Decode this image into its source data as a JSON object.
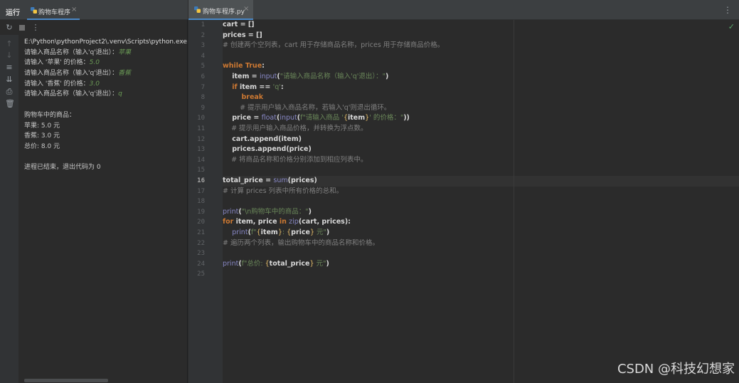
{
  "run_panel": {
    "title": "运行",
    "tab_label": "购物车程序",
    "tab_close": "×",
    "console_lines": [
      {
        "text": "E:\\Python\\pythonProject2\\.venv\\Scripts\\python.exe",
        "input": ""
      },
      {
        "text": "请输入商品名称（输入'q'退出）：",
        "input": "苹果"
      },
      {
        "text": "请输入 '苹果' 的价格：",
        "input": "5.0"
      },
      {
        "text": "请输入商品名称（输入'q'退出）：",
        "input": "香蕉"
      },
      {
        "text": "请输入 '香蕉' 的价格：",
        "input": "3.0"
      },
      {
        "text": "请输入商品名称（输入'q'退出）：",
        "input": "q"
      },
      {
        "text": "",
        "input": ""
      },
      {
        "text": "购物车中的商品：",
        "input": ""
      },
      {
        "text": "苹果: 5.0 元",
        "input": ""
      },
      {
        "text": "香蕉: 3.0 元",
        "input": ""
      },
      {
        "text": "总价: 8.0 元",
        "input": ""
      },
      {
        "text": "",
        "input": ""
      },
      {
        "text": "进程已结束，退出代码为 0",
        "input": ""
      }
    ]
  },
  "editor": {
    "tab_label": "购物车程序.py",
    "tab_close": "×",
    "current_line": 16,
    "lines": [
      [
        [
          "txt",
          "cart = []"
        ]
      ],
      [
        [
          "txt",
          "prices = []"
        ]
      ],
      [
        [
          "cm",
          "# 创建两个空列表，cart 用于存储商品名称，prices 用于存储商品价格。"
        ]
      ],
      [],
      [
        [
          "kw",
          "while "
        ],
        [
          "kw",
          "True"
        ],
        [
          "txt",
          ":"
        ]
      ],
      [
        [
          "txt",
          "    item = "
        ],
        [
          "fn",
          "input"
        ],
        [
          "txt",
          "("
        ],
        [
          "str",
          "\"请输入商品名称（输入'q'退出）：\""
        ],
        [
          "txt",
          ")"
        ]
      ],
      [
        [
          "txt",
          "    "
        ],
        [
          "kw",
          "if "
        ],
        [
          "txt",
          "item == "
        ],
        [
          "str",
          "'q'"
        ],
        [
          "txt",
          ":"
        ]
      ],
      [
        [
          "txt",
          "        "
        ],
        [
          "kw",
          "break"
        ]
      ],
      [
        [
          "cm",
          "        # 提示用户输入商品名称，若输入'q'则退出循环。"
        ]
      ],
      [
        [
          "txt",
          "    price = "
        ],
        [
          "fn",
          "float"
        ],
        [
          "txt",
          "("
        ],
        [
          "fn",
          "input"
        ],
        [
          "txt",
          "("
        ],
        [
          "str",
          "f\"请输入商品 '"
        ],
        [
          "br",
          "{"
        ],
        [
          "txt",
          "item"
        ],
        [
          "br",
          "}"
        ],
        [
          "str",
          "' 的价格：\""
        ],
        [
          "txt",
          "))"
        ]
      ],
      [
        [
          "cm",
          "    # 提示用户输入商品价格，并转换为浮点数。"
        ]
      ],
      [
        [
          "txt",
          "    cart.append(item)"
        ]
      ],
      [
        [
          "txt",
          "    prices.append(price)"
        ]
      ],
      [
        [
          "cm",
          "    # 将商品名称和价格分别添加到相应列表中。"
        ]
      ],
      [],
      [
        [
          "txt",
          "total_price = "
        ],
        [
          "fn",
          "sum"
        ],
        [
          "txt",
          "(prices)"
        ]
      ],
      [
        [
          "cm",
          "# 计算 prices 列表中所有价格的总和。"
        ]
      ],
      [],
      [
        [
          "fn",
          "print"
        ],
        [
          "txt",
          "("
        ],
        [
          "str",
          "\"\\n购物车中的商品：\""
        ],
        [
          "txt",
          ")"
        ]
      ],
      [
        [
          "kw",
          "for "
        ],
        [
          "txt",
          "item, price "
        ],
        [
          "kw",
          "in "
        ],
        [
          "fn",
          "zip"
        ],
        [
          "txt",
          "(cart, prices):"
        ]
      ],
      [
        [
          "txt",
          "    "
        ],
        [
          "fn",
          "print"
        ],
        [
          "txt",
          "("
        ],
        [
          "str",
          "f\""
        ],
        [
          "br",
          "{"
        ],
        [
          "txt",
          "item"
        ],
        [
          "br",
          "}"
        ],
        [
          "str",
          ": "
        ],
        [
          "br",
          "{"
        ],
        [
          "txt",
          "price"
        ],
        [
          "br",
          "}"
        ],
        [
          "str",
          " 元\""
        ],
        [
          "txt",
          ")"
        ]
      ],
      [
        [
          "cm",
          "# 遍历两个列表，输出购物车中的商品名称和价格。"
        ]
      ],
      [],
      [
        [
          "fn",
          "print"
        ],
        [
          "txt",
          "("
        ],
        [
          "str",
          "f\"总价: "
        ],
        [
          "br",
          "{"
        ],
        [
          "txt",
          "total_price"
        ],
        [
          "br",
          "}"
        ],
        [
          "str",
          " 元\""
        ],
        [
          "txt",
          ")"
        ]
      ],
      []
    ]
  },
  "watermark": "CSDN @科技幻想家",
  "icons": [
    "rerun-icon",
    "stop-icon",
    "more-icon",
    "up-arrow-icon",
    "down-arrow-icon",
    "soft-wrap-icon",
    "scroll-end-icon",
    "print-icon",
    "trash-icon",
    "python-file-icon",
    "kebab-menu-icon",
    "check-icon"
  ]
}
